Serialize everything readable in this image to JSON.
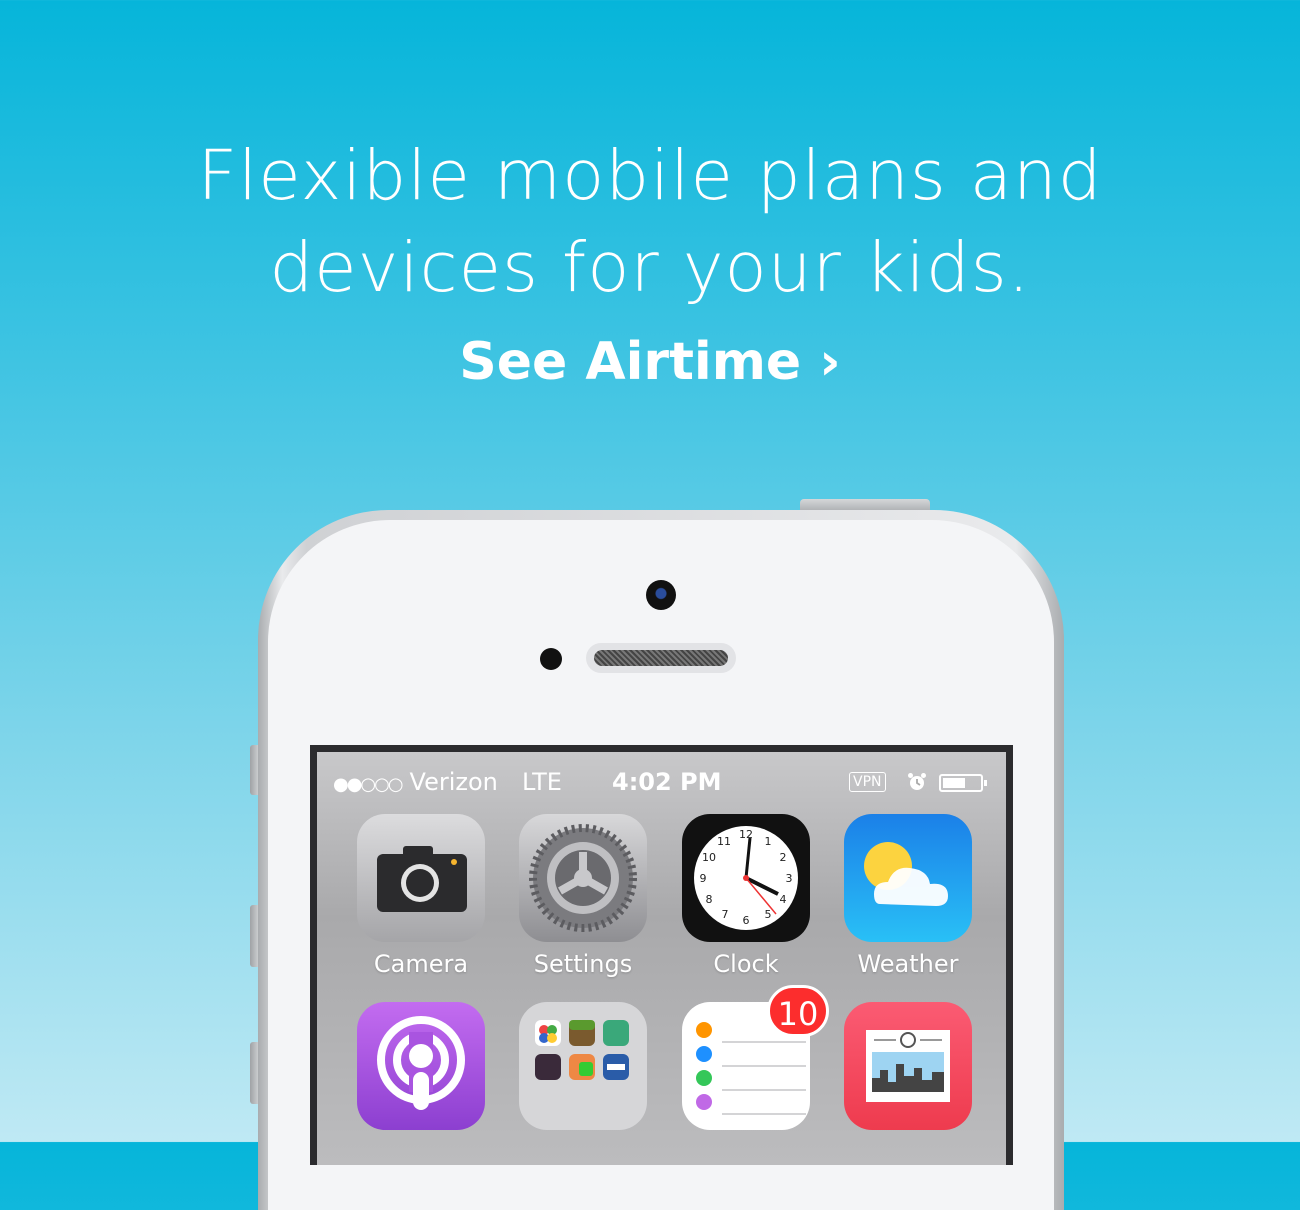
{
  "headline": {
    "line1": "Flexible mobile plans and",
    "line2": "devices for your kids."
  },
  "cta": {
    "label": "See Airtime ›"
  },
  "status_bar": {
    "signal": "●●○○○",
    "carrier": "Verizon",
    "network": "LTE",
    "time": "4:02 PM",
    "vpn": "VPN"
  },
  "apps": [
    {
      "label": "Camera",
      "icon": "camera-icon"
    },
    {
      "label": "Settings",
      "icon": "gear-icon"
    },
    {
      "label": "Clock",
      "icon": "clock-icon"
    },
    {
      "label": "Weather",
      "icon": "weather-icon"
    },
    {
      "label": "",
      "icon": "podcasts-icon"
    },
    {
      "label": "",
      "icon": "app-folder-icon"
    },
    {
      "label": "",
      "icon": "reminders-icon"
    },
    {
      "label": "",
      "icon": "news-icon"
    }
  ],
  "badges": {
    "reminders": "10"
  },
  "colors": {
    "background_top": "#06b5da",
    "background_bottom": "#bfe9f4",
    "badge": "#fc2d2d",
    "weather_tile": "#1a9bf0",
    "podcasts_tile": "#9b4fd8",
    "news_tile": "#f2455a"
  }
}
